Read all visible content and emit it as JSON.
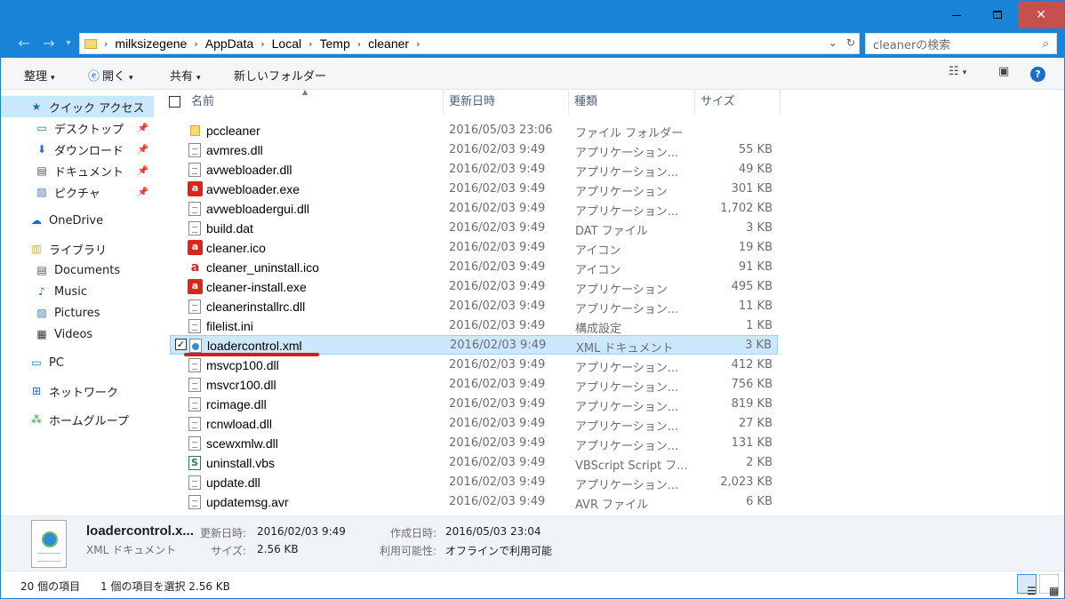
{
  "window": {
    "title_buttons": {
      "minimize": "minimize-icon",
      "maximize": "maximize-icon",
      "close": "close-icon"
    },
    "accent": "#1883d7"
  },
  "nav": {
    "breadcrumb": [
      "milksizegene",
      "AppData",
      "Local",
      "Temp",
      "cleaner"
    ],
    "search_placeholder": "cleanerの検索"
  },
  "toolbar": {
    "organize": "整理",
    "open": "開く",
    "share": "共有",
    "new_folder": "新しいフォルダー"
  },
  "sidebar": {
    "quick_access": "クイック アクセス",
    "desktop": "デスクトップ",
    "downloads": "ダウンロード",
    "documents_jp": "ドキュメント",
    "pictures_jp": "ピクチャ",
    "onedrive": "OneDrive",
    "library": "ライブラリ",
    "documents": "Documents",
    "music": "Music",
    "pictures": "Pictures",
    "videos": "Videos",
    "pc": "PC",
    "network": "ネットワーク",
    "homegroup": "ホームグループ"
  },
  "columns": {
    "name": "名前",
    "date": "更新日時",
    "type": "種類",
    "size": "サイズ"
  },
  "files": [
    {
      "name": "pccleaner",
      "date": "2016/05/03 23:06",
      "type": "ファイル フォルダー",
      "size": "",
      "icon": "folder"
    },
    {
      "name": "avmres.dll",
      "date": "2016/02/03 9:49",
      "type": "アプリケーション...",
      "size": "55 KB",
      "icon": "doc"
    },
    {
      "name": "avwebloader.dll",
      "date": "2016/02/03 9:49",
      "type": "アプリケーション...",
      "size": "49 KB",
      "icon": "doc"
    },
    {
      "name": "avwebloader.exe",
      "date": "2016/02/03 9:49",
      "type": "アプリケーション",
      "size": "301 KB",
      "icon": "red"
    },
    {
      "name": "avwebloadergui.dll",
      "date": "2016/02/03 9:49",
      "type": "アプリケーション...",
      "size": "1,702 KB",
      "icon": "doc"
    },
    {
      "name": "build.dat",
      "date": "2016/02/03 9:49",
      "type": "DAT ファイル",
      "size": "3 KB",
      "icon": "doc"
    },
    {
      "name": "cleaner.ico",
      "date": "2016/02/03 9:49",
      "type": "アイコン",
      "size": "19 KB",
      "icon": "red"
    },
    {
      "name": "cleaner_uninstall.ico",
      "date": "2016/02/03 9:49",
      "type": "アイコン",
      "size": "91 KB",
      "icon": "redline"
    },
    {
      "name": "cleaner-install.exe",
      "date": "2016/02/03 9:49",
      "type": "アプリケーション",
      "size": "495 KB",
      "icon": "red"
    },
    {
      "name": "cleanerinstallrc.dll",
      "date": "2016/02/03 9:49",
      "type": "アプリケーション...",
      "size": "11 KB",
      "icon": "doc"
    },
    {
      "name": "filelist.ini",
      "date": "2016/02/03 9:49",
      "type": "構成設定",
      "size": "1 KB",
      "icon": "doc"
    },
    {
      "name": "loadercontrol.xml",
      "date": "2016/02/03 9:49",
      "type": "XML ドキュメント",
      "size": "3 KB",
      "icon": "xml",
      "selected": true
    },
    {
      "name": "msvcp100.dll",
      "date": "2016/02/03 9:49",
      "type": "アプリケーション...",
      "size": "412 KB",
      "icon": "doc"
    },
    {
      "name": "msvcr100.dll",
      "date": "2016/02/03 9:49",
      "type": "アプリケーション...",
      "size": "756 KB",
      "icon": "doc"
    },
    {
      "name": "rcimage.dll",
      "date": "2016/02/03 9:49",
      "type": "アプリケーション...",
      "size": "819 KB",
      "icon": "doc"
    },
    {
      "name": "rcnwload.dll",
      "date": "2016/02/03 9:49",
      "type": "アプリケーション...",
      "size": "27 KB",
      "icon": "doc"
    },
    {
      "name": "scewxmlw.dll",
      "date": "2016/02/03 9:49",
      "type": "アプリケーション...",
      "size": "131 KB",
      "icon": "doc"
    },
    {
      "name": "uninstall.vbs",
      "date": "2016/02/03 9:49",
      "type": "VBScript Script フ...",
      "size": "2 KB",
      "icon": "vbs"
    },
    {
      "name": "update.dll",
      "date": "2016/02/03 9:49",
      "type": "アプリケーション...",
      "size": "2,023 KB",
      "icon": "doc"
    },
    {
      "name": "updatemsg.avr",
      "date": "2016/02/03 9:49",
      "type": "AVR ファイル",
      "size": "6 KB",
      "icon": "doc"
    }
  ],
  "details": {
    "name": "loadercontrol.x...",
    "type": "XML ドキュメント",
    "modified_label": "更新日時:",
    "modified": "2016/02/03 9:49",
    "size_label": "サイズ:",
    "size": "2.56 KB",
    "created_label": "作成日時:",
    "created": "2016/05/03 23:04",
    "availability_label": "利用可能性:",
    "availability": "オフラインで利用可能"
  },
  "status": {
    "count": "20 個の項目",
    "selection": "1 個の項目を選択  2.56 KB"
  }
}
